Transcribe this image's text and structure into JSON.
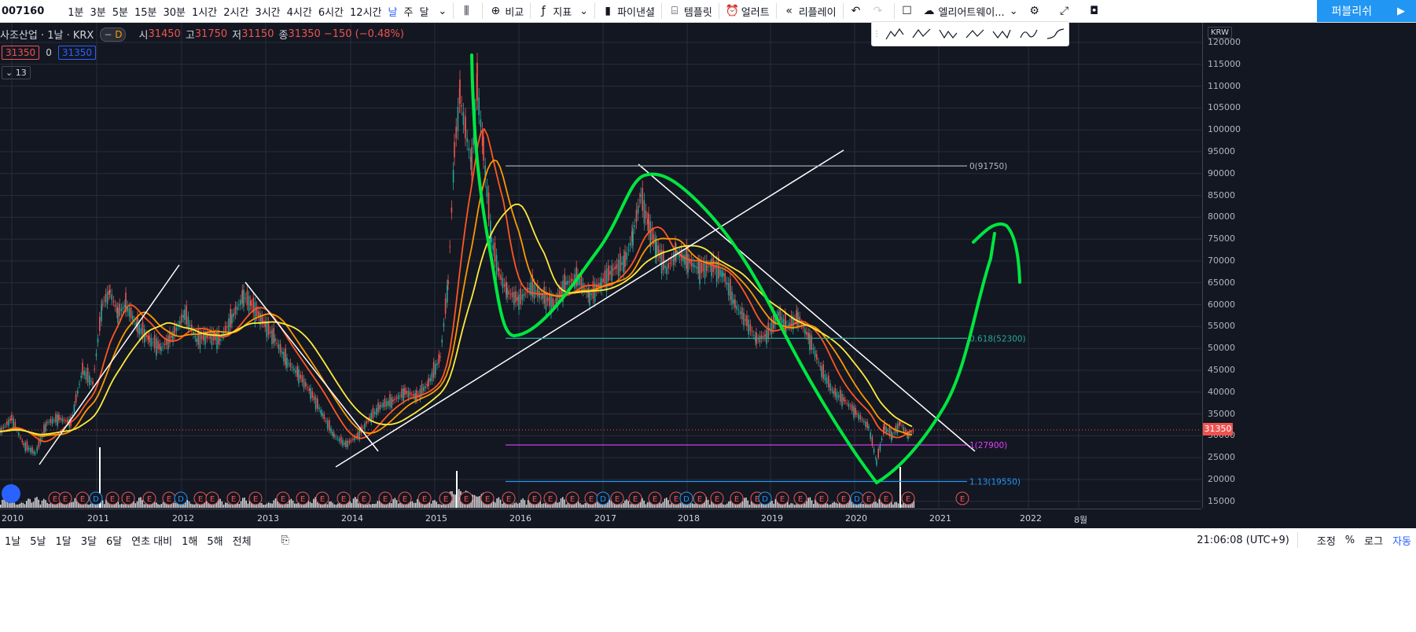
{
  "toolbar": {
    "symbol": "007160",
    "intervals": [
      "1분",
      "3분",
      "5분",
      "15분",
      "30분",
      "1시간",
      "2시간",
      "3시간",
      "4시간",
      "6시간",
      "12시간",
      "날",
      "주",
      "달"
    ],
    "active_interval": "날",
    "compare": "비교",
    "indicators": "지표",
    "financials": "파이낸셜",
    "templates": "템플릿",
    "alerts": "얼러트",
    "replay": "리플레이",
    "layout_name": "엘리어트웨이...",
    "publish": "퍼블리쉬"
  },
  "legend": {
    "title": "사조산업 · 1날 · KRX",
    "badge": "D",
    "open_label": "시",
    "open": "31450",
    "high_label": "고",
    "high": "31750",
    "low_label": "저",
    "low": "31150",
    "close_label": "종",
    "close": "31350",
    "change": "−150 (−0.48%)",
    "bid": "31350",
    "spread": "0",
    "ask": "31350",
    "indicators_count": "13"
  },
  "price_scale": {
    "currency": "KRW",
    "labels": [
      "120000",
      "115000",
      "110000",
      "105000",
      "100000",
      "95000",
      "90000",
      "85000",
      "80000",
      "75000",
      "70000",
      "65000",
      "60000",
      "55000",
      "50000",
      "45000",
      "40000",
      "35000",
      "30000",
      "25000",
      "20000",
      "15000"
    ],
    "last_price": "31350"
  },
  "time_axis": [
    "2010",
    "2011",
    "2012",
    "2013",
    "2014",
    "2015",
    "2016",
    "2017",
    "2018",
    "2019",
    "2020",
    "2021",
    "2022",
    "8월"
  ],
  "fib_levels": [
    {
      "label": "0(91750)",
      "color": "#b2b5be"
    },
    {
      "label": "0.618(52300)",
      "color": "#26a69a"
    },
    {
      "label": "1(27900)",
      "color": "#e040fb"
    },
    {
      "label": "1.13(19550)",
      "color": "#2196f3"
    }
  ],
  "bottom": {
    "ranges": [
      "1날",
      "5날",
      "1달",
      "3달",
      "6달",
      "연초 대비",
      "1해",
      "5해",
      "전체"
    ],
    "time": "21:06:08 (UTC+9)",
    "adjust": "조정",
    "percent": "%",
    "log": "로그",
    "auto": "자동"
  },
  "colors": {
    "up": "#26a69a",
    "down": "#ef5350",
    "drawing_green": "#00e640",
    "ma_yellow": "#ffeb3b",
    "ma_orange": "#ff9800"
  }
}
